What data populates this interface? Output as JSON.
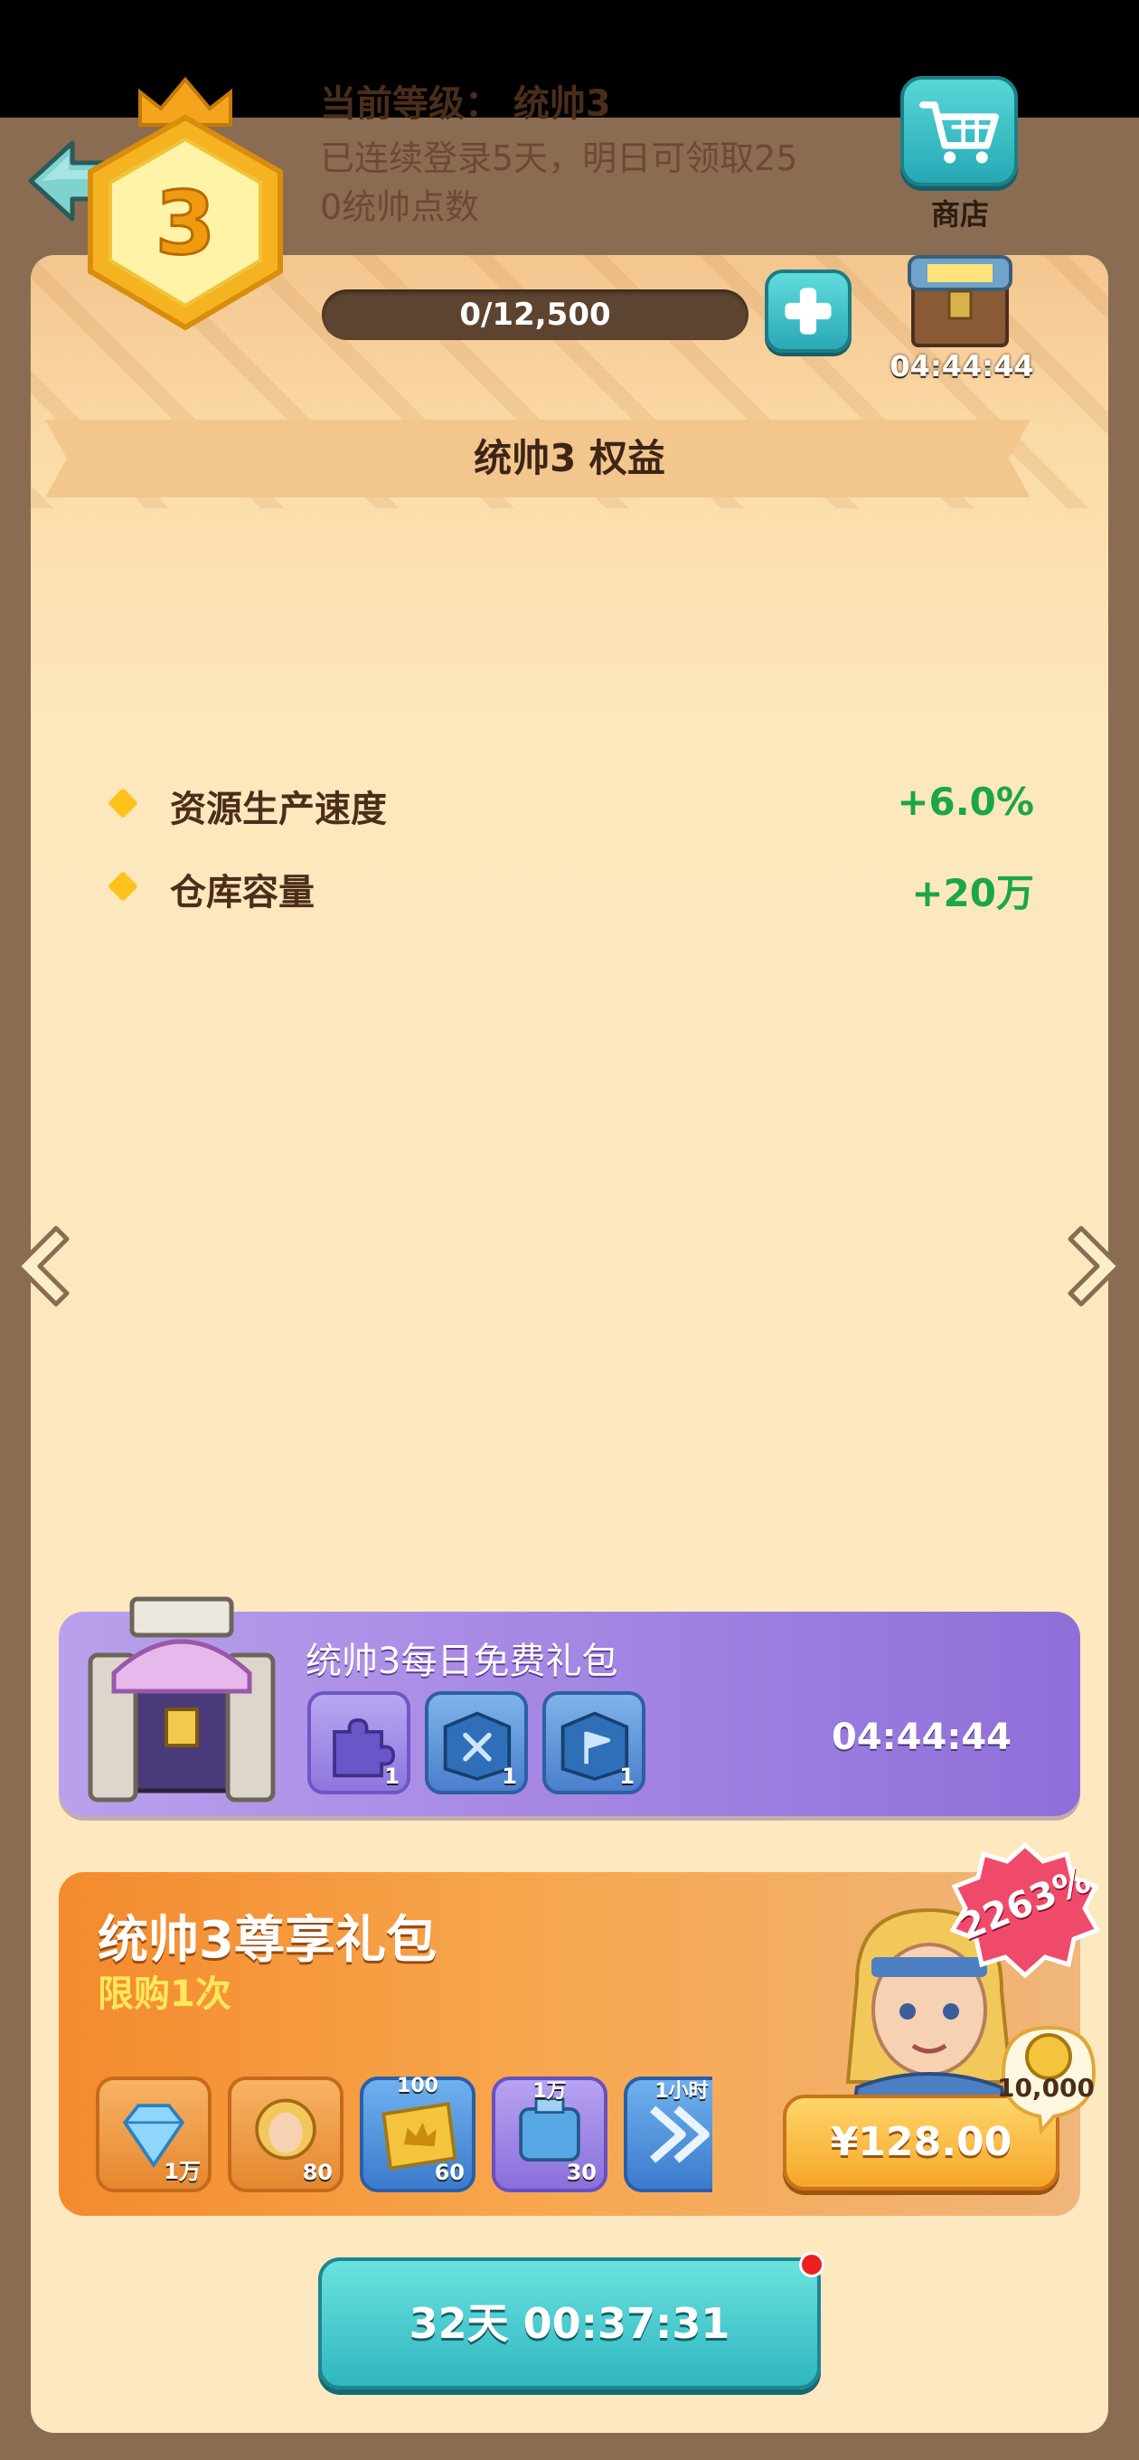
{
  "header": {
    "title": "统帅"
  },
  "status": {
    "level_text": "当前等级： 统帅3",
    "login_line1": "已连续登录5天，明日可领取25",
    "login_line2": "0统帅点数",
    "badge_number": "3",
    "progress_text": "0/12,500",
    "progress_fraction": 0,
    "shop_label": "商店",
    "chest_timer": "04:44:44"
  },
  "benefits": {
    "title": "统帅3 权益",
    "items": [
      {
        "label": "资源生产速度",
        "value": "+6.0%"
      },
      {
        "label": "仓库容量",
        "value": "+20万"
      }
    ]
  },
  "daily_pack": {
    "title": "统帅3每日免费礼包",
    "items": [
      {
        "icon": "puzzle-piece-icon",
        "count": "1"
      },
      {
        "icon": "blue-book-swords-icon",
        "count": "1"
      },
      {
        "icon": "blue-book-flag-icon",
        "count": "1"
      }
    ],
    "timer": "04:44:44"
  },
  "premium_pack": {
    "title": "统帅3尊享礼包",
    "limit": "限购1次",
    "bonus": "2263%",
    "coin_amount": "10,000",
    "price": "¥128.00",
    "items": [
      {
        "icon": "diamond-icon",
        "top": "",
        "count": "1万"
      },
      {
        "icon": "hero-token-icon",
        "top": "",
        "count": "80"
      },
      {
        "icon": "crown-card-icon",
        "top": "100",
        "count": "60"
      },
      {
        "icon": "potion-icon",
        "top": "1万",
        "count": "30"
      },
      {
        "icon": "speedup-icon",
        "top": "1小时",
        "count": ""
      }
    ]
  },
  "footer": {
    "timer": "32天 00:37:31"
  },
  "colors": {
    "accent_teal": "#2fb6c0",
    "benefit_green": "#1aa64a",
    "panel_bg": "#fde8c1"
  }
}
